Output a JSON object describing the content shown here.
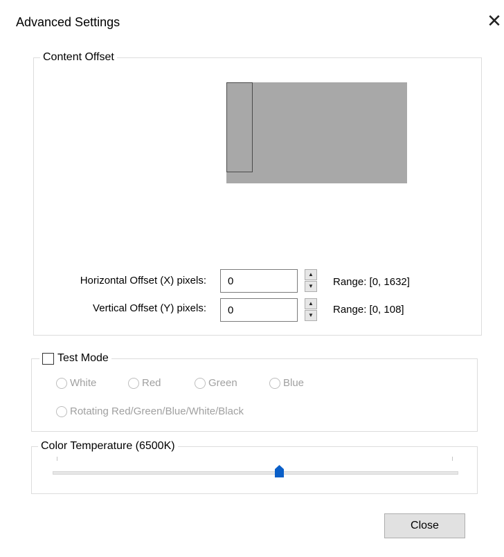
{
  "window": {
    "title": "Advanced Settings",
    "close_glyph": "✕"
  },
  "content_offset": {
    "legend": "Content Offset",
    "horizontal": {
      "label": "Horizontal Offset (X) pixels:",
      "value": "0",
      "range": "Range: [0, 1632]"
    },
    "vertical": {
      "label": "Vertical Offset (Y) pixels:",
      "value": "0",
      "range": "Range: [0, 108]"
    },
    "preview": {
      "screen_color": "#a8a8a8",
      "window_border_color": "#4a4a4a"
    }
  },
  "test_mode": {
    "label": "Test Mode",
    "checked": false,
    "options": [
      {
        "label": "White",
        "selected": false
      },
      {
        "label": "Red",
        "selected": false
      },
      {
        "label": "Green",
        "selected": false
      },
      {
        "label": "Blue",
        "selected": false
      },
      {
        "label": "Rotating Red/Green/Blue/White/Black",
        "selected": false
      }
    ],
    "disabled_text_color": "#a0a0a0"
  },
  "color_temperature": {
    "legend": "Color Temperature (6500K)",
    "slider_position": 0.55,
    "thumb_color": "#0a5fc8"
  },
  "footer": {
    "close_label": "Close"
  },
  "icons": {
    "close": "close-icon",
    "spin_up": "arrow-up-icon",
    "spin_down": "arrow-down-icon",
    "slider_thumb": "slider-thumb-icon"
  }
}
